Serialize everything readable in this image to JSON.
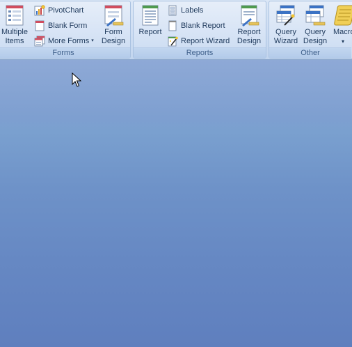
{
  "ribbon": {
    "forms": {
      "title": "Forms",
      "multiple_items": {
        "line1": "Multiple",
        "line2": "Items",
        "icon": "multiple-items-icon"
      },
      "pivotchart": {
        "label": "PivotChart",
        "icon": "pivotchart-icon"
      },
      "blank_form": {
        "label": "Blank Form",
        "icon": "blank-form-icon"
      },
      "more_forms": {
        "label": "More Forms",
        "arrow": "▾",
        "icon": "more-forms-icon"
      },
      "form_design": {
        "line1": "Form",
        "line2": "Design",
        "icon": "form-design-icon"
      }
    },
    "reports": {
      "title": "Reports",
      "report": {
        "label": "Report",
        "icon": "report-icon"
      },
      "labels": {
        "label": "Labels",
        "icon": "labels-icon"
      },
      "blank_report": {
        "label": "Blank Report",
        "icon": "blank-report-icon"
      },
      "report_wizard": {
        "label": "Report Wizard",
        "icon": "report-wizard-icon"
      },
      "report_design": {
        "line1": "Report",
        "line2": "Design",
        "icon": "report-design-icon"
      }
    },
    "other": {
      "title": "Other",
      "query_wizard": {
        "line1": "Query",
        "line2": "Wizard",
        "icon": "query-wizard-icon"
      },
      "query_design": {
        "line1": "Query",
        "line2": "Design",
        "icon": "query-design-icon"
      },
      "macro": {
        "label": "Macro",
        "arrow": "▾",
        "icon": "macro-icon"
      }
    }
  },
  "colors": {
    "ribbon_bg": "#cfdef3",
    "text": "#1e395b",
    "group_title_text": "#3e5f8a",
    "workspace_top": "#8ea9d6",
    "workspace_bottom": "#5f7fbe"
  }
}
